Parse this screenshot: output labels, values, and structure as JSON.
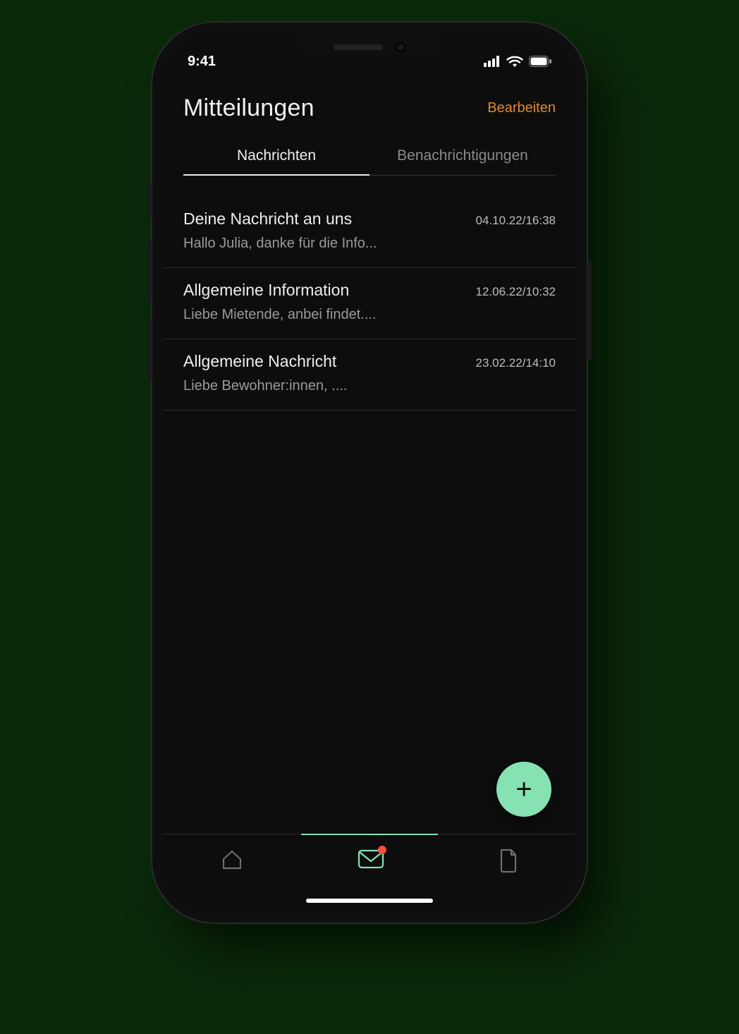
{
  "status_bar": {
    "time": "9:41"
  },
  "header": {
    "title": "Mitteilungen",
    "edit_label": "Bearbeiten"
  },
  "tabs": [
    {
      "label": "Nachrichten",
      "active": true
    },
    {
      "label": "Benachrichtigungen",
      "active": false
    }
  ],
  "messages": [
    {
      "title": "Deine Nachricht an uns",
      "preview": "Hallo Julia, danke für die Info...",
      "timestamp": "04.10.22/16:38"
    },
    {
      "title": "Allgemeine Information",
      "preview": "Liebe Mietende, anbei findet....",
      "timestamp": "12.06.22/10:32"
    },
    {
      "title": "Allgemeine Nachricht",
      "preview": "Liebe Bewohner:innen, ....",
      "timestamp": "23.02.22/14:10"
    }
  ],
  "fab": {
    "label": "+"
  },
  "bottom_nav": {
    "items": [
      "home",
      "messages",
      "documents"
    ],
    "active_index": 1,
    "badge_index": 1
  },
  "colors": {
    "accent_orange": "#e08a2c",
    "accent_mint": "#86e2b3",
    "badge_red": "#ff4d3d"
  }
}
